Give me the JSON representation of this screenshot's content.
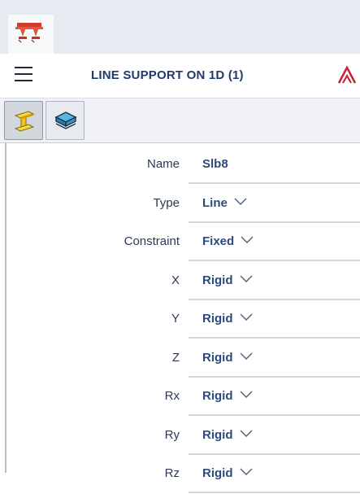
{
  "title": "LINE SUPPORT ON 1D (1)",
  "icons": {
    "app": "support-structure-icon",
    "menu": "hamburger-menu-icon",
    "brand": "brand-logo-icon",
    "tool_1": "beam-properties-icon",
    "tool_2": "slab-layers-icon",
    "dropdown": "chevron-down-icon"
  },
  "colors": {
    "accent_dark": "#1f3a6b",
    "value_text": "#2d4a7a",
    "app_icon": "#d23a2a",
    "brand": "#c0283a",
    "tool_yellow": "#f3c41b"
  },
  "properties": [
    {
      "label": "Name",
      "value": "Slb8",
      "dropdown": false
    },
    {
      "label": "Type",
      "value": "Line",
      "dropdown": true
    },
    {
      "label": "Constraint",
      "value": "Fixed",
      "dropdown": true
    },
    {
      "label": "X",
      "value": "Rigid",
      "dropdown": true
    },
    {
      "label": "Y",
      "value": "Rigid",
      "dropdown": true
    },
    {
      "label": "Z",
      "value": "Rigid",
      "dropdown": true
    },
    {
      "label": "Rx",
      "value": "Rigid",
      "dropdown": true
    },
    {
      "label": "Ry",
      "value": "Rigid",
      "dropdown": true
    },
    {
      "label": "Rz",
      "value": "Rigid",
      "dropdown": true
    }
  ]
}
